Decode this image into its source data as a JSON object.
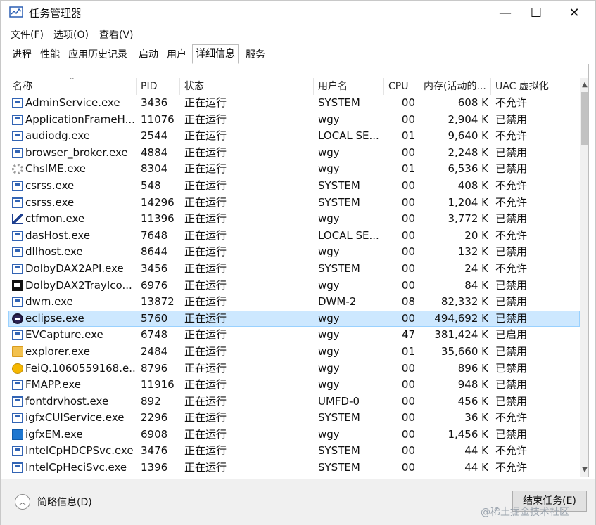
{
  "window": {
    "title": "任务管理器",
    "min_glyph": "—",
    "max_glyph": "☐",
    "close_glyph": "✕"
  },
  "menu": [
    "文件(F)",
    "选项(O)",
    "查看(V)"
  ],
  "tabs": [
    {
      "label": "进程",
      "active": false
    },
    {
      "label": "性能",
      "active": false
    },
    {
      "label": "应用历史记录",
      "active": false
    },
    {
      "label": "启动",
      "active": false
    },
    {
      "label": "用户",
      "active": false
    },
    {
      "label": "详细信息",
      "active": true
    },
    {
      "label": "服务",
      "active": false
    }
  ],
  "table": {
    "columns": {
      "name": "名称",
      "pid": "PID",
      "status": "状态",
      "user": "用户名",
      "cpu": "CPU",
      "mem": "内存(活动的...",
      "uac": "UAC 虚拟化"
    },
    "sort_glyph": "^",
    "rows": [
      {
        "icon": "app-icon",
        "name": "AdminService.exe",
        "pid": "3436",
        "status": "正在运行",
        "user": "SYSTEM",
        "cpu": "00",
        "mem": "608 K",
        "uac": "不允许"
      },
      {
        "icon": "app-icon",
        "name": "ApplicationFrameH...",
        "pid": "11076",
        "status": "正在运行",
        "user": "wgy",
        "cpu": "00",
        "mem": "2,904 K",
        "uac": "已禁用"
      },
      {
        "icon": "app-icon",
        "name": "audiodg.exe",
        "pid": "2544",
        "status": "正在运行",
        "user": "LOCAL SE...",
        "cpu": "01",
        "mem": "9,640 K",
        "uac": "不允许"
      },
      {
        "icon": "app-icon",
        "name": "browser_broker.exe",
        "pid": "4884",
        "status": "正在运行",
        "user": "wgy",
        "cpu": "00",
        "mem": "2,248 K",
        "uac": "已禁用"
      },
      {
        "icon": "gear-icon",
        "name": "ChsIME.exe",
        "pid": "8304",
        "status": "正在运行",
        "user": "wgy",
        "cpu": "01",
        "mem": "6,536 K",
        "uac": "已禁用"
      },
      {
        "icon": "app-icon",
        "name": "csrss.exe",
        "pid": "548",
        "status": "正在运行",
        "user": "SYSTEM",
        "cpu": "00",
        "mem": "408 K",
        "uac": "不允许"
      },
      {
        "icon": "app-icon",
        "name": "csrss.exe",
        "pid": "14296",
        "status": "正在运行",
        "user": "SYSTEM",
        "cpu": "00",
        "mem": "1,204 K",
        "uac": "不允许"
      },
      {
        "icon": "pen-icon",
        "name": "ctfmon.exe",
        "pid": "11396",
        "status": "正在运行",
        "user": "wgy",
        "cpu": "00",
        "mem": "3,772 K",
        "uac": "已禁用"
      },
      {
        "icon": "app-icon",
        "name": "dasHost.exe",
        "pid": "7648",
        "status": "正在运行",
        "user": "LOCAL SE...",
        "cpu": "00",
        "mem": "20 K",
        "uac": "不允许"
      },
      {
        "icon": "app-icon",
        "name": "dllhost.exe",
        "pid": "8644",
        "status": "正在运行",
        "user": "wgy",
        "cpu": "00",
        "mem": "132 K",
        "uac": "已禁用"
      },
      {
        "icon": "app-icon",
        "name": "DolbyDAX2API.exe",
        "pid": "3456",
        "status": "正在运行",
        "user": "SYSTEM",
        "cpu": "00",
        "mem": "24 K",
        "uac": "不允许"
      },
      {
        "icon": "dolby-icon",
        "name": "DolbyDAX2TrayIco...",
        "pid": "6976",
        "status": "正在运行",
        "user": "wgy",
        "cpu": "00",
        "mem": "84 K",
        "uac": "已禁用"
      },
      {
        "icon": "app-icon",
        "name": "dwm.exe",
        "pid": "13872",
        "status": "正在运行",
        "user": "DWM-2",
        "cpu": "08",
        "mem": "82,332 K",
        "uac": "已禁用"
      },
      {
        "icon": "eclipse-icon",
        "name": "eclipse.exe",
        "pid": "5760",
        "status": "正在运行",
        "user": "wgy",
        "cpu": "00",
        "mem": "494,692 K",
        "uac": "已禁用",
        "selected": true
      },
      {
        "icon": "app-icon",
        "name": "EVCapture.exe",
        "pid": "6748",
        "status": "正在运行",
        "user": "wgy",
        "cpu": "47",
        "mem": "381,424 K",
        "uac": "已启用"
      },
      {
        "icon": "folder-icon",
        "name": "explorer.exe",
        "pid": "2484",
        "status": "正在运行",
        "user": "wgy",
        "cpu": "01",
        "mem": "35,660 K",
        "uac": "已禁用"
      },
      {
        "icon": "feiq-icon",
        "name": "FeiQ.1060559168.e...",
        "pid": "8796",
        "status": "正在运行",
        "user": "wgy",
        "cpu": "00",
        "mem": "896 K",
        "uac": "已禁用"
      },
      {
        "icon": "app-icon",
        "name": "FMAPP.exe",
        "pid": "11916",
        "status": "正在运行",
        "user": "wgy",
        "cpu": "00",
        "mem": "948 K",
        "uac": "已禁用"
      },
      {
        "icon": "app-icon",
        "name": "fontdrvhost.exe",
        "pid": "892",
        "status": "正在运行",
        "user": "UMFD-0",
        "cpu": "00",
        "mem": "456 K",
        "uac": "已禁用"
      },
      {
        "icon": "app-icon",
        "name": "igfxCUIService.exe",
        "pid": "2296",
        "status": "正在运行",
        "user": "SYSTEM",
        "cpu": "00",
        "mem": "36 K",
        "uac": "不允许"
      },
      {
        "icon": "igfx-icon",
        "name": "igfxEM.exe",
        "pid": "6908",
        "status": "正在运行",
        "user": "wgy",
        "cpu": "00",
        "mem": "1,456 K",
        "uac": "已禁用"
      },
      {
        "icon": "app-icon",
        "name": "IntelCpHDCPSvc.exe",
        "pid": "3476",
        "status": "正在运行",
        "user": "SYSTEM",
        "cpu": "00",
        "mem": "44 K",
        "uac": "不允许"
      },
      {
        "icon": "app-icon",
        "name": "IntelCpHeciSvc.exe",
        "pid": "1396",
        "status": "正在运行",
        "user": "SYSTEM",
        "cpu": "00",
        "mem": "44 K",
        "uac": "不允许"
      }
    ]
  },
  "footer": {
    "fewer_details": "简略信息(D)",
    "end_task": "结束任务(E)",
    "chevron_glyph": "︿"
  },
  "watermark": "@稀土掘金技术社区"
}
